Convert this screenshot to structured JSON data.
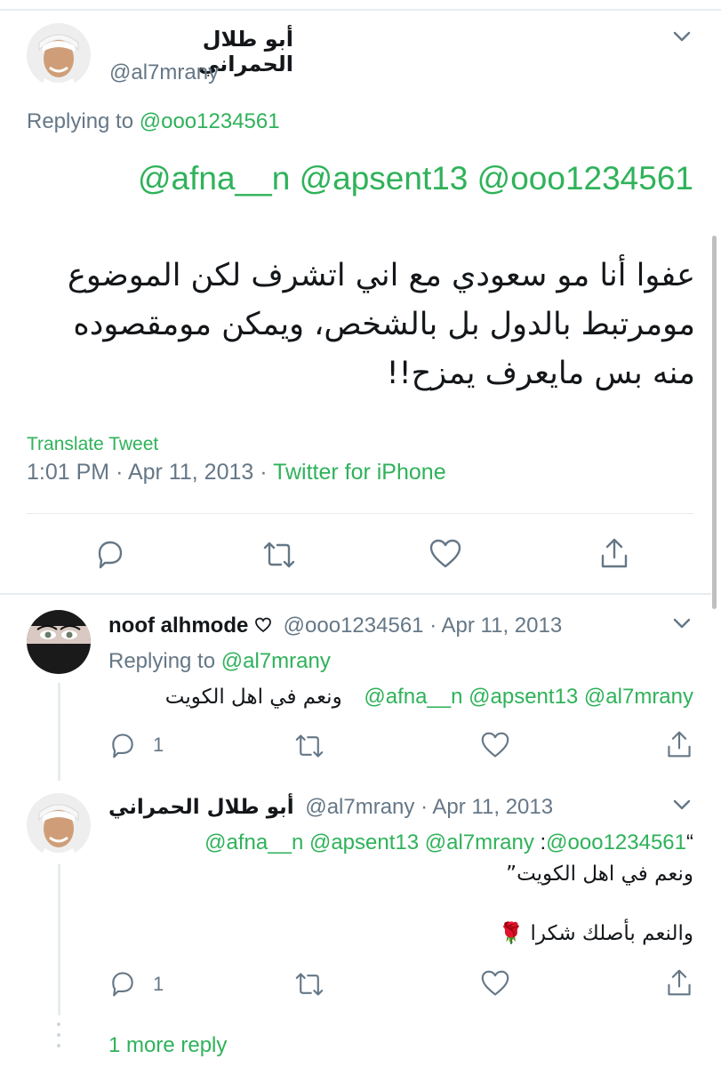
{
  "main_tweet": {
    "display_name": "أبو طلال الحمراني",
    "handle": "@al7mrany",
    "replying_label": "Replying to",
    "replying_handle": "@ooo1234561",
    "mentions": "@afna__n @apsent13 @ooo1234561",
    "body_line1": "عفوا أنا مو سعودي مع اني اتشرف لكن الموضوع",
    "body_line2": "مومرتبط بالدول بل بالشخص، ويمكن مومقصوده",
    "body_line3": "منه بس مايعرف يمزح!!",
    "translate_label": "Translate Tweet",
    "time": "1:01 PM",
    "date": "Apr 11, 2013",
    "source": "Twitter for iPhone"
  },
  "reply1": {
    "display_name": "noof alhmode",
    "name_icon": "heart",
    "handle": "@ooo1234561",
    "date": "Apr 11, 2013",
    "replying_label": "Replying to",
    "replying_handle": "@al7mrany",
    "mentions": "@afna__n @apsent13 @al7mrany",
    "body": "ونعم في اهل الكويت",
    "reply_count": "1"
  },
  "reply2": {
    "display_name": "أبو طلال الحمراني",
    "handle": "@al7mrany",
    "date": "Apr 11, 2013",
    "quote_open": "“",
    "quote_handle": "@ooo1234561",
    "quote_colon": ":",
    "quote_mentions": "@afna__n @apsent13 @al7mrany",
    "quote_line2": "ونعم في اهل الكويت”",
    "body": "والنعم بأصلك شكرا",
    "emoji": "🌹",
    "reply_count": "1"
  },
  "more_replies": "1 more reply",
  "colors": {
    "accent": "#2fb25a",
    "secondary_text": "#657786",
    "divider": "#e6ecf0"
  }
}
